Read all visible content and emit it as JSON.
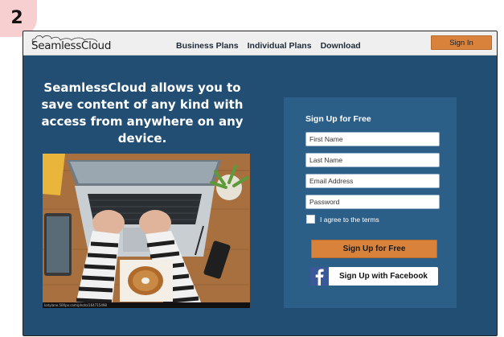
{
  "step": {
    "number": "2"
  },
  "nav": {
    "logo_text": "SeamlessCloud",
    "links": [
      "Business Plans",
      "Individual Plans",
      "Download"
    ],
    "signin_label": "Sign In"
  },
  "hero": {
    "headline_lines": [
      "SeamlessCloud allows you to",
      "save content of any kind with",
      "access from anywhere on any",
      "device."
    ],
    "photo_credit": "katylane.500px.com/photo/164715498"
  },
  "signup": {
    "title": "Sign Up for Free",
    "fields": {
      "first_name": "First Name",
      "last_name": "Last Name",
      "email": "Email Address",
      "password": "Password"
    },
    "terms_label": "I agree to the terms",
    "submit_label": "Sign Up for Free",
    "facebook_label": "Sign Up with Facebook"
  },
  "colors": {
    "background": "#234e74",
    "panel": "#2c5f88",
    "accent_orange": "#d8823b",
    "facebook_blue": "#3b5998",
    "badge_pink": "#f8cfd1"
  },
  "icons": [
    "cloud-logo-icon",
    "facebook-icon"
  ]
}
